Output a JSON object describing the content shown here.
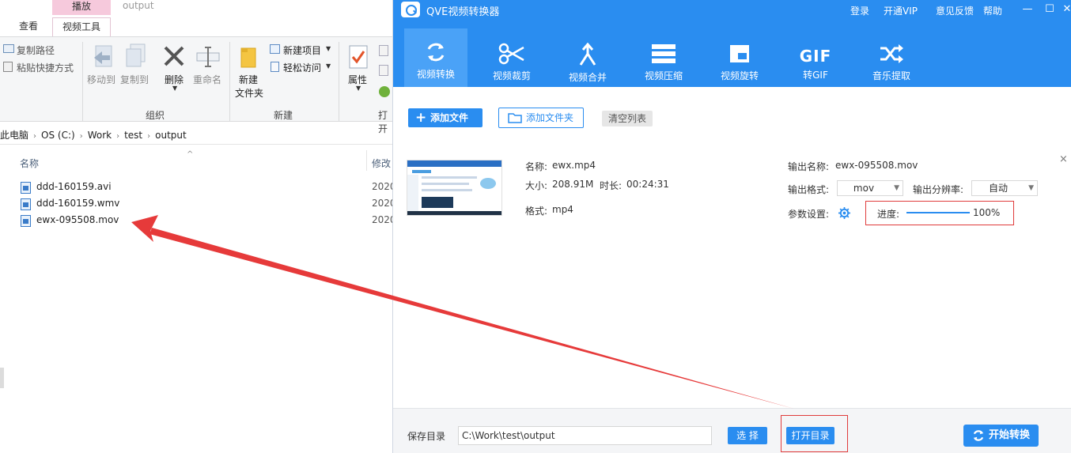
{
  "explorer": {
    "window_title": "output",
    "contextual_tab_header": "播放",
    "tabs": {
      "view": "查看",
      "video_tools": "视频工具"
    },
    "ribbon": {
      "copy_path": "复制路径",
      "paste_shortcut": "粘贴快捷方式",
      "move_to": "移动到",
      "copy_to": "复制到",
      "delete": "删除",
      "rename": "重命名",
      "organize_group": "组织",
      "new_folder_line1": "新建",
      "new_folder_line2": "文件夹",
      "new_item": "新建项目",
      "easy_access": "轻松访问",
      "new_group": "新建",
      "properties": "属性",
      "open_group": "打开"
    },
    "address": [
      "此电脑",
      "OS (C:)",
      "Work",
      "test",
      "output"
    ],
    "columns": {
      "name": "名称",
      "modified": "修改"
    },
    "files": [
      {
        "name": "ddd-160159.avi",
        "date": "2020"
      },
      {
        "name": "ddd-160159.wmv",
        "date": "2020"
      },
      {
        "name": "ewx-095508.mov",
        "date": "2020"
      }
    ]
  },
  "app": {
    "title": "QVE视频转换器",
    "header_links": {
      "login": "登录",
      "vip": "开通VIP",
      "feedback": "意见反馈",
      "help": "帮助"
    },
    "window_controls": {
      "minimize": "—",
      "maximize": "☐",
      "close": "✕"
    },
    "tools": [
      {
        "label": "视频转换",
        "icon": "convert-icon"
      },
      {
        "label": "视频裁剪",
        "icon": "scissors-icon"
      },
      {
        "label": "视频合并",
        "icon": "merge-icon"
      },
      {
        "label": "视频压缩",
        "icon": "compress-icon"
      },
      {
        "label": "视频旋转",
        "icon": "rotate-icon"
      },
      {
        "label": "转GIF",
        "icon": "gif-icon",
        "icon_text": "GIF"
      },
      {
        "label": "音乐提取",
        "icon": "shuffle-icon"
      }
    ],
    "actions": {
      "add_file": "添加文件",
      "add_folder": "添加文件夹",
      "clear_list": "清空列表"
    },
    "item": {
      "name_label": "名称:",
      "name": "ewx.mp4",
      "size_label": "大小:",
      "size": "208.91M",
      "duration_label": "时长:",
      "duration": "00:24:31",
      "format_label": "格式:",
      "format": "mp4",
      "output_name_label": "输出名称:",
      "output_name": "ewx-095508.mov",
      "output_format_label": "输出格式:",
      "output_format": "mov",
      "output_res_label": "输出分辨率:",
      "output_res": "自动",
      "params_label": "参数设置:",
      "progress_label": "进度:",
      "progress_text": "100%",
      "progress": 1.0
    },
    "footer": {
      "save_dir_label": "保存目录",
      "save_dir": "C:\\Work\\test\\output",
      "choose": "选 择",
      "open_dir": "打开目录",
      "start": "开始转换"
    }
  },
  "colors": {
    "brand_blue": "#2a8df0",
    "annotation_red": "#e03c3c",
    "contextual_pink": "#f6c9dc"
  }
}
